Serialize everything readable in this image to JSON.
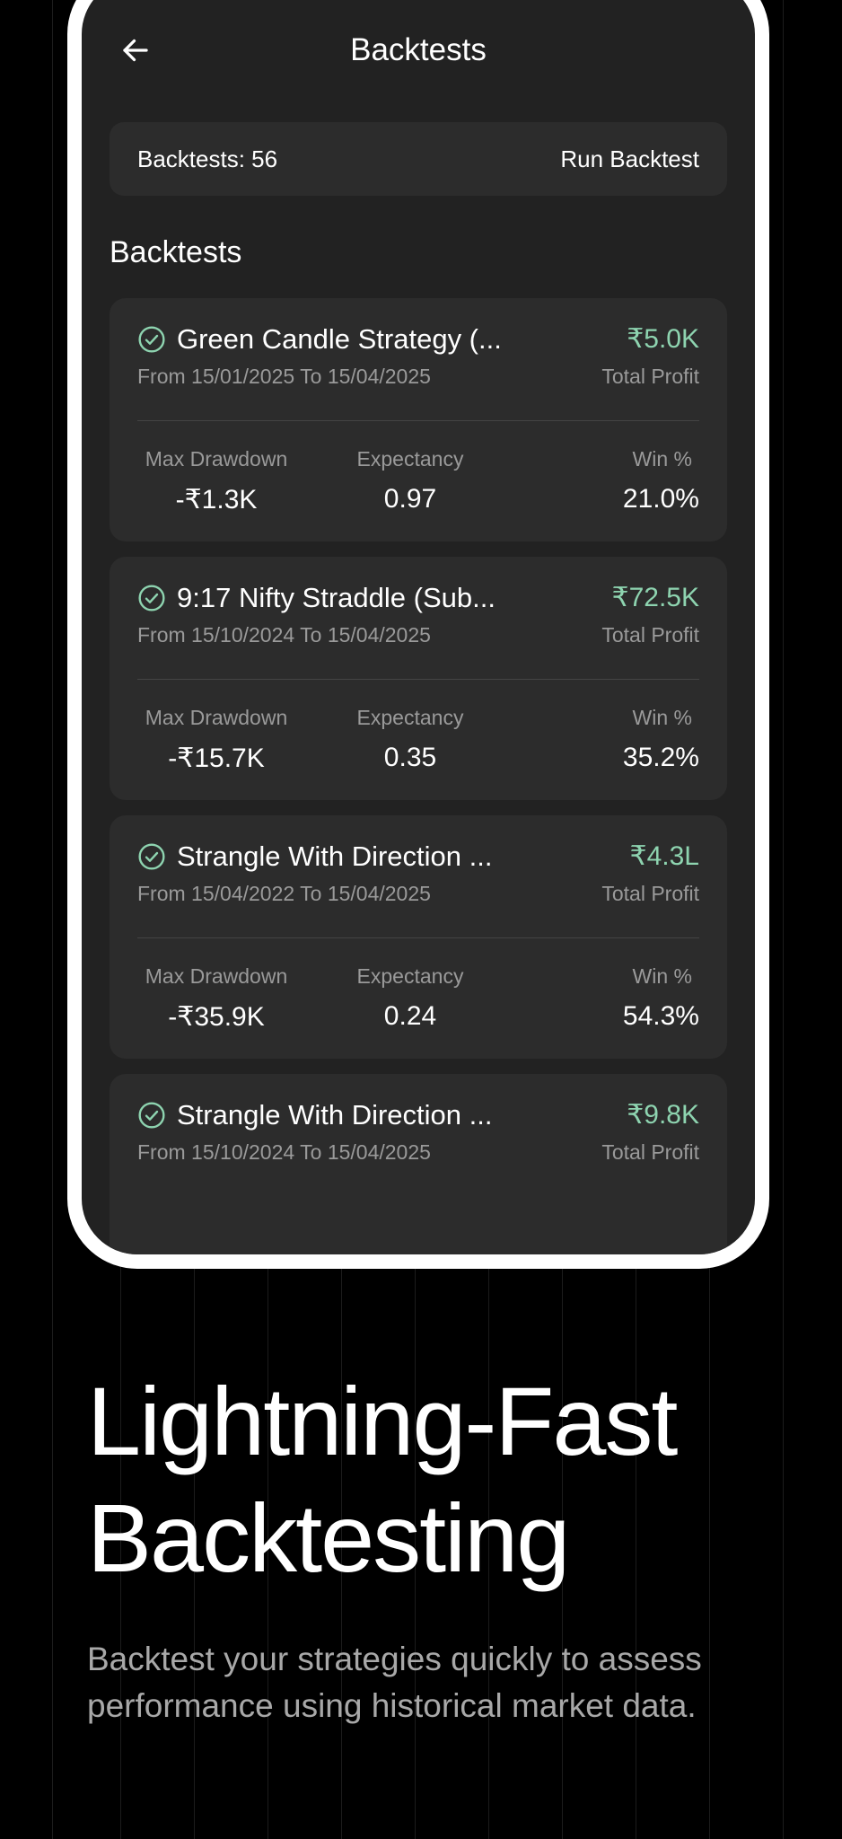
{
  "header": {
    "title": "Backtests"
  },
  "summary": {
    "count_text": "Backtests: 56",
    "run_button": "Run Backtest"
  },
  "section_title": "Backtests",
  "stat_labels": {
    "max_drawdown": "Max Drawdown",
    "expectancy": "Expectancy",
    "win": "Win %"
  },
  "profit_label": "Total Profit",
  "colors": {
    "profit": "#8ed4b0",
    "card_bg": "#2c2c2c",
    "screen_bg": "#222222"
  },
  "backtests": [
    {
      "name": "Green Candle Strategy (...",
      "dates": "From 15/01/2025 To 15/04/2025",
      "profit": "₹5.0K",
      "max_drawdown": "-₹1.3K",
      "expectancy": "0.97",
      "win": "21.0%"
    },
    {
      "name": "9:17 Nifty Straddle (Sub...",
      "dates": "From 15/10/2024 To 15/04/2025",
      "profit": "₹72.5K",
      "max_drawdown": "-₹15.7K",
      "expectancy": "0.35",
      "win": "35.2%"
    },
    {
      "name": "Strangle With Direction ...",
      "dates": "From 15/04/2022 To 15/04/2025",
      "profit": "₹4.3L",
      "max_drawdown": "-₹35.9K",
      "expectancy": "0.24",
      "win": "54.3%"
    },
    {
      "name": "Strangle With Direction ...",
      "dates": "From 15/10/2024 To 15/04/2025",
      "profit": "₹9.8K"
    }
  ],
  "hero": {
    "title_line1": "Lightning-Fast",
    "title_line2": "Backtesting",
    "subtitle": "Backtest your strategies quickly to assess performance using historical market data."
  },
  "icons": {
    "back": "arrow-left-icon",
    "status": "check-circle-icon"
  }
}
